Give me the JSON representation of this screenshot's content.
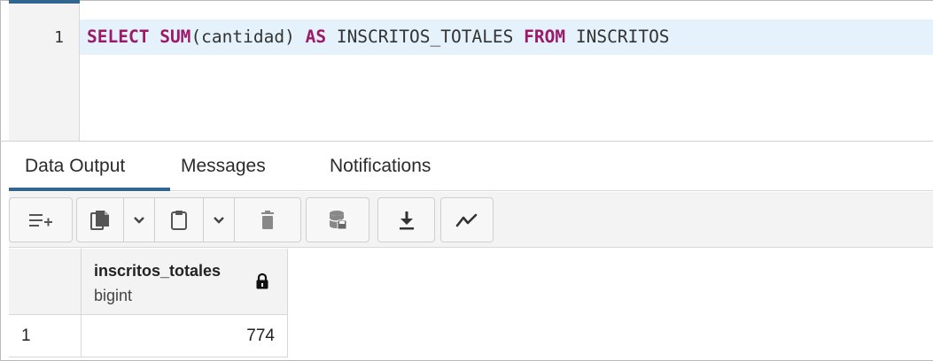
{
  "editor": {
    "line_number": "1",
    "tokens": {
      "select": "SELECT",
      "sum": "SUM",
      "args": "(cantidad)",
      "as": "AS",
      "alias": "INSCRITOS_TOTALES",
      "from": "FROM",
      "table": "INSCRITOS"
    }
  },
  "tabs": [
    {
      "label": "Data Output",
      "active": true
    },
    {
      "label": "Messages",
      "active": false
    },
    {
      "label": "Notifications",
      "active": false
    }
  ],
  "toolbar": {
    "icons": [
      "add-row-icon",
      "copy-icon",
      "copy-dropdown-icon",
      "paste-icon",
      "paste-dropdown-icon",
      "delete-icon",
      "save-data-icon",
      "download-icon",
      "graph-visualiser-icon"
    ]
  },
  "result_grid": {
    "columns": [
      {
        "name": "inscritos_totales",
        "type": "bigint",
        "locked": true
      }
    ],
    "rows": [
      {
        "row_number": "1",
        "values": [
          "774"
        ]
      }
    ]
  },
  "colors": {
    "accent": "#326690",
    "keyword": "#9b1b6a",
    "line_highlight": "#e5f2fb"
  }
}
